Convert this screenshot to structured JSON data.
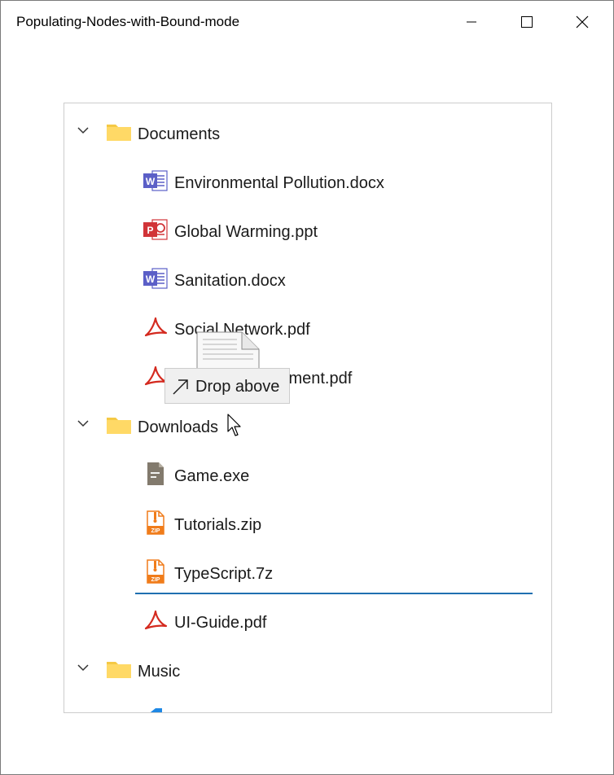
{
  "window": {
    "title": "Populating-Nodes-with-Bound-mode",
    "controls": [
      "minimize-icon",
      "maximize-icon",
      "close-icon"
    ]
  },
  "tree": {
    "folders": [
      {
        "label": "Documents",
        "icon": "folder-icon",
        "expanded": true,
        "children": [
          {
            "label": "Environmental Pollution.docx",
            "icon": "word-icon"
          },
          {
            "label": "Global Warming.ppt",
            "icon": "powerpoint-icon"
          },
          {
            "label": "Sanitation.docx",
            "icon": "word-icon"
          },
          {
            "label": "Social Network.pdf",
            "icon": "pdf-icon"
          },
          {
            "label": "Youth Empowerment.pdf",
            "icon": "pdf-icon"
          }
        ]
      },
      {
        "label": "Downloads",
        "icon": "folder-icon",
        "expanded": true,
        "children": [
          {
            "label": "Game.exe",
            "icon": "exe-icon"
          },
          {
            "label": "Tutorials.zip",
            "icon": "zip-icon"
          },
          {
            "label": "TypeScript.7z",
            "icon": "zip-icon"
          },
          {
            "label": "UI-Guide.pdf",
            "icon": "pdf-icon"
          }
        ]
      },
      {
        "label": "Music",
        "icon": "folder-icon",
        "expanded": true,
        "children": []
      }
    ]
  },
  "drag": {
    "tooltip_text": "Drop above",
    "drop_target": "UI-Guide.pdf",
    "drop_position": "above"
  },
  "colors": {
    "folder": "#ffd966",
    "word": "#5b5fc7",
    "powerpoint": "#d13438",
    "pdf": "#d42a1f",
    "zip": "#f07c1a",
    "exe": "#827a6d",
    "drop_line": "#1f6fb0"
  }
}
